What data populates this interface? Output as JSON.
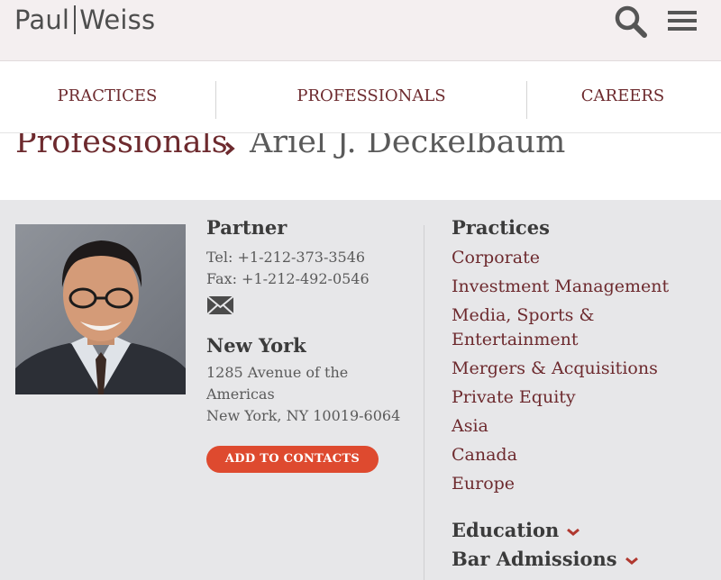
{
  "header": {
    "logo_left": "Paul",
    "logo_right": "Weiss",
    "search_icon": "search-icon",
    "menu_icon": "hamburger-menu-icon"
  },
  "nav": {
    "items": [
      {
        "label": "PRACTICES"
      },
      {
        "label": "PROFESSIONALS"
      },
      {
        "label": "CAREERS"
      }
    ]
  },
  "breadcrumb": {
    "parent": "Professionals",
    "current": "Ariel J. Deckelbaum"
  },
  "profile": {
    "title": "Partner",
    "tel": "Tel: +1-212-373-3546",
    "fax": "Fax: +1-212-492-0546",
    "email_icon": "envelope-icon",
    "office": {
      "city": "New York",
      "address_line1": "1285 Avenue of the",
      "address_line2": "Americas",
      "address_line3": "New York, NY 10019-6064"
    },
    "add_to_contacts": "ADD TO CONTACTS"
  },
  "practices": {
    "heading": "Practices",
    "items": [
      "Corporate",
      "Investment Management",
      "Media, Sports &",
      "Entertainment",
      "Mergers & Acquisitions",
      "Private Equity",
      "Asia",
      "Canada",
      "Europe"
    ]
  },
  "sections": {
    "education": "Education",
    "bar_admissions": "Bar Admissions"
  },
  "colors": {
    "brand_maroon": "#6d2a2e",
    "accent_orange": "#de4a2f",
    "header_bg": "#f4eff0",
    "panel_bg": "#e7e7e9"
  }
}
